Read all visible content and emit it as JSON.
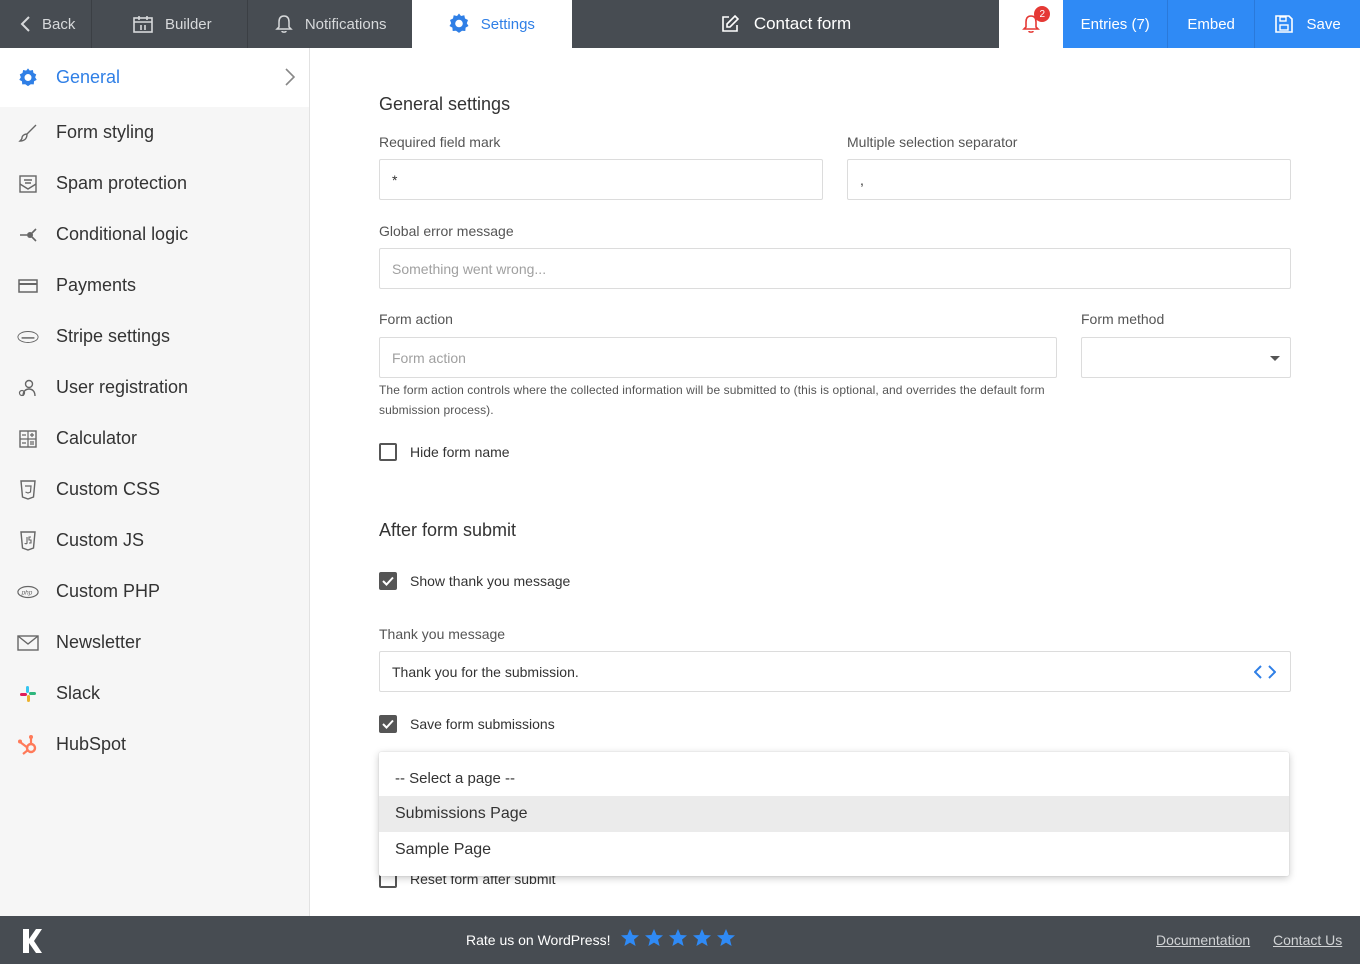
{
  "topbar": {
    "back_label": "Back",
    "builder_label": "Builder",
    "notifications_label": "Notifications",
    "settings_label": "Settings",
    "form_title": "Contact form",
    "bell_badge": "2",
    "entries_label": "Entries (7)",
    "embed_label": "Embed",
    "save_label": "Save"
  },
  "sidebar": {
    "items": [
      {
        "label": "General",
        "icon": "gear-icon"
      },
      {
        "label": "Form styling",
        "icon": "brush-icon"
      },
      {
        "label": "Spam protection",
        "icon": "spam-icon"
      },
      {
        "label": "Conditional logic",
        "icon": "logic-icon"
      },
      {
        "label": "Payments",
        "icon": "card-icon"
      },
      {
        "label": "Stripe settings",
        "icon": "stripe-icon"
      },
      {
        "label": "User registration",
        "icon": "user-icon"
      },
      {
        "label": "Calculator",
        "icon": "calculator-icon"
      },
      {
        "label": "Custom CSS",
        "icon": "css-icon"
      },
      {
        "label": "Custom JS",
        "icon": "js-icon"
      },
      {
        "label": "Custom PHP",
        "icon": "php-icon"
      },
      {
        "label": "Newsletter",
        "icon": "envelope-icon"
      },
      {
        "label": "Slack",
        "icon": "slack-icon"
      },
      {
        "label": "HubSpot",
        "icon": "hubspot-icon"
      }
    ]
  },
  "general": {
    "heading": "General settings",
    "required_mark_label": "Required field mark",
    "required_mark_value": "*",
    "separator_label": "Multiple selection separator",
    "separator_value": ",",
    "global_error_label": "Global error message",
    "global_error_placeholder": "Something went wrong...",
    "form_action_label": "Form action",
    "form_action_placeholder": "Form action",
    "form_method_label": "Form method",
    "form_action_help": "The form action controls where the collected information will be submitted to (this is optional, and overrides the default form submission process).",
    "hide_form_name_label": "Hide form name"
  },
  "after_submit": {
    "heading": "After form submit",
    "show_thank_you_label": "Show thank you message",
    "thank_you_label": "Thank you message",
    "thank_you_value": "Thank you for the submission.",
    "save_submissions_label": "Save form submissions",
    "reset_form_label": "Reset form after submit"
  },
  "dropdown": {
    "options": [
      "-- Select a page --",
      "Submissions Page",
      "Sample Page"
    ],
    "highlighted": "Submissions Page"
  },
  "footer": {
    "rate_text": "Rate us on WordPress!",
    "stars": 5,
    "documentation_label": "Documentation",
    "contact_label": "Contact Us"
  },
  "colors": {
    "accent": "#2f7fe6",
    "topbar": "#474c52",
    "button_blue": "#2f8af5",
    "badge_red": "#e53935"
  }
}
